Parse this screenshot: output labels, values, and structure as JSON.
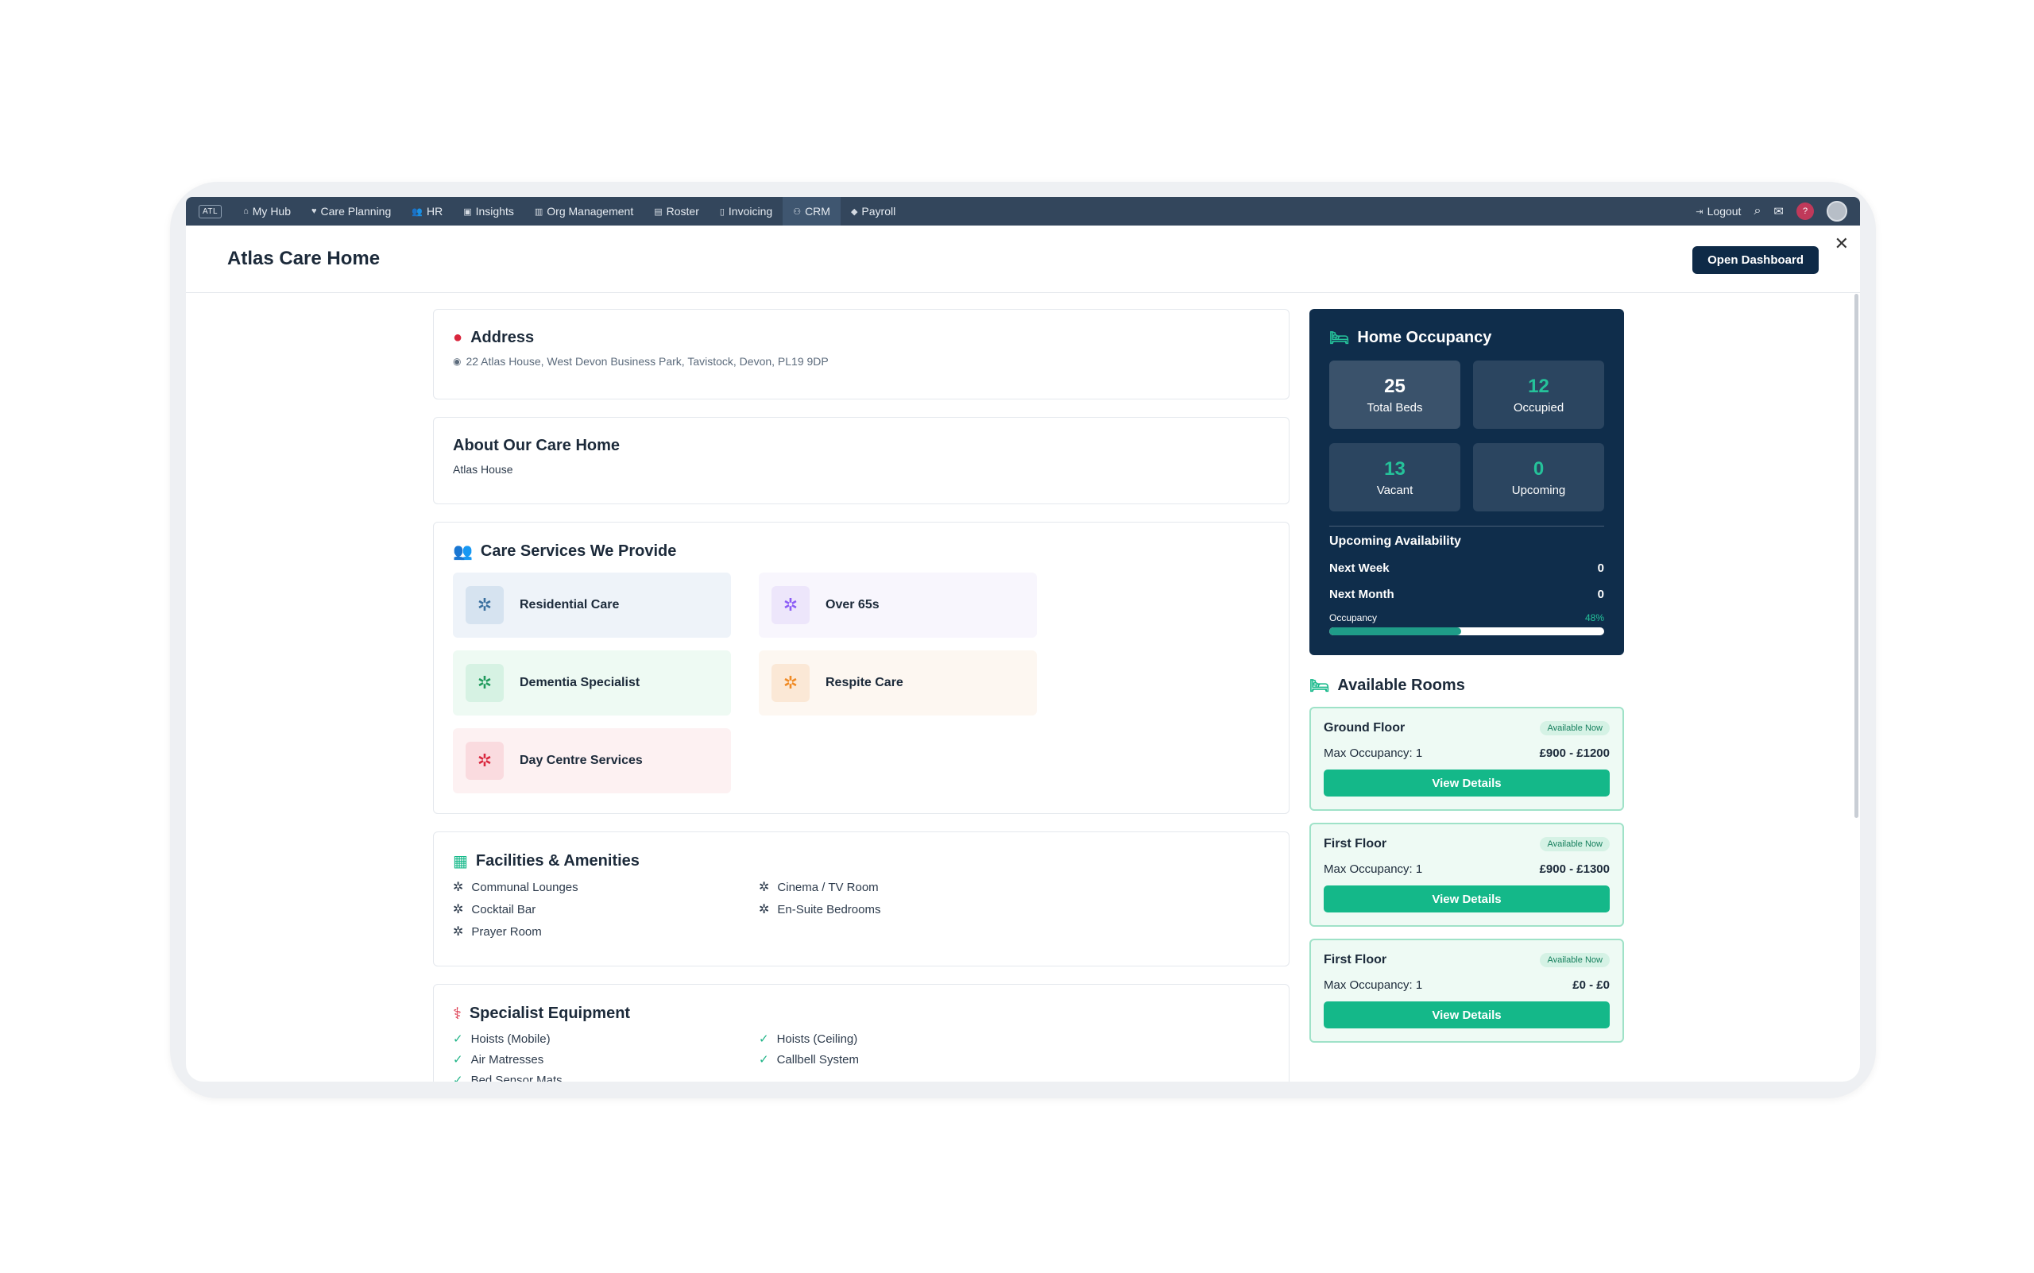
{
  "nav": {
    "logo": "ATL",
    "items": [
      {
        "icon": "home-icon",
        "label": "My Hub"
      },
      {
        "icon": "heart-icon",
        "label": "Care Planning"
      },
      {
        "icon": "people-icon",
        "label": "HR"
      },
      {
        "icon": "chart-icon",
        "label": "Insights"
      },
      {
        "icon": "building-icon",
        "label": "Org Management"
      },
      {
        "icon": "calendar-icon",
        "label": "Roster"
      },
      {
        "icon": "document-icon",
        "label": "Invoicing"
      },
      {
        "icon": "users-icon",
        "label": "CRM"
      },
      {
        "icon": "tag-icon",
        "label": "Payroll"
      }
    ],
    "active": "CRM",
    "logout": "Logout",
    "help_badge": "?"
  },
  "header": {
    "title": "Atlas Care Home",
    "open_dashboard": "Open Dashboard",
    "close": "✕"
  },
  "address": {
    "title": "Address",
    "value": "22 Atlas House, West Devon Business Park, Tavistock, Devon, PL19 9DP"
  },
  "about": {
    "title": "About Our Care Home",
    "value": "Atlas House"
  },
  "services": {
    "title": "Care Services We Provide",
    "items": [
      {
        "label": "Residential Care",
        "bg": "#eef3f9",
        "sq": "#d6e3f0",
        "color": "#3a6f9e"
      },
      {
        "label": "Over 65s",
        "bg": "#f8f6fd",
        "sq": "#ede6fb",
        "color": "#8b5cf6"
      },
      {
        "label": "Dementia Specialist",
        "bg": "#eefaf3",
        "sq": "#d6f2e3",
        "color": "#1f9a5c"
      },
      {
        "label": "Respite Care",
        "bg": "#fdf7f1",
        "sq": "#fbe8d6",
        "color": "#f08a24"
      },
      {
        "label": "Day Centre Services",
        "bg": "#fdf1f2",
        "sq": "#fadbdf",
        "color": "#d9263d"
      }
    ]
  },
  "facilities": {
    "title": "Facilities & Amenities",
    "items": [
      "Communal Lounges",
      "Cinema / TV Room",
      "Cocktail Bar",
      "En-Suite Bedrooms",
      "Prayer Room"
    ]
  },
  "equipment": {
    "title": "Specialist Equipment",
    "items": [
      "Hoists (Mobile)",
      "Hoists (Ceiling)",
      "Air Matresses",
      "Callbell System",
      "Bed Sensor Mats"
    ]
  },
  "occupancy": {
    "title": "Home Occupancy",
    "total_beds": "25",
    "total_beds_label": "Total Beds",
    "occupied": "12",
    "occupied_label": "Occupied",
    "vacant": "13",
    "vacant_label": "Vacant",
    "upcoming": "0",
    "upcoming_label": "Upcoming",
    "upcoming_title": "Upcoming Availability",
    "next_week_label": "Next Week",
    "next_week": "0",
    "next_month_label": "Next Month",
    "next_month": "0",
    "occupancy_label": "Occupancy",
    "occupancy_pct": "48%",
    "occupancy_fraction": 0.48
  },
  "rooms": {
    "title": "Available Rooms",
    "items": [
      {
        "floor": "Ground Floor",
        "status": "Available Now",
        "occupancy": "Max Occupancy: 1",
        "price": "£900 - £1200",
        "button": "View Details"
      },
      {
        "floor": "First Floor",
        "status": "Available Now",
        "occupancy": "Max Occupancy: 1",
        "price": "£900 - £1300",
        "button": "View Details"
      },
      {
        "floor": "First Floor",
        "status": "Available Now",
        "occupancy": "Max Occupancy: 1",
        "price": "£0 - £0",
        "button": "View Details"
      }
    ]
  },
  "colors": {
    "nav_bg": "#33465c",
    "primary_dark": "#0e2a47",
    "teal": "#14b889",
    "address_pin": "#d9263d"
  }
}
